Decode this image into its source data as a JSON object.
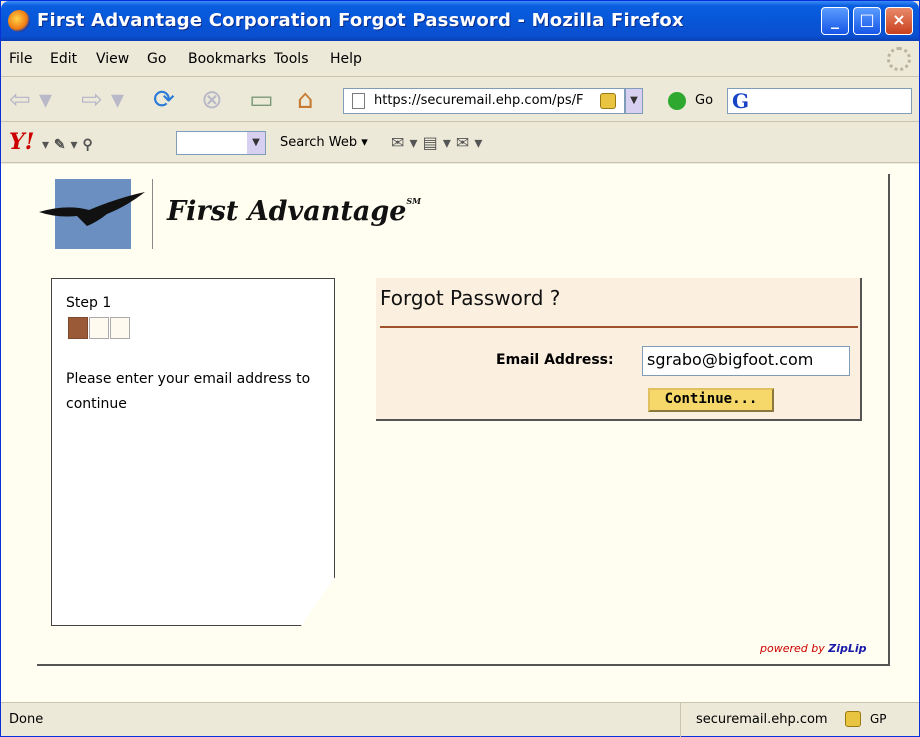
{
  "window": {
    "title": "First Advantage Corporation Forgot Password - Mozilla Firefox"
  },
  "menu": [
    "File",
    "Edit",
    "View",
    "Go",
    "Bookmarks",
    "Tools",
    "Help"
  ],
  "navbar": {
    "url": "https://securemail.ehp.com/ps/F",
    "go_label": "Go"
  },
  "yahoo": {
    "search_web": "Search Web ▾"
  },
  "page": {
    "brand": "First Advantage",
    "brand_mark": "SM",
    "step_label": "Step 1",
    "step_text": "Please enter your email address to continue",
    "form_title": "Forgot Password ?",
    "email_label": "Email Address:",
    "email_value": "sgrabo@bigfoot.com",
    "continue_label": "Continue...",
    "powered_by": "powered by",
    "powered_brand": "ZipLip"
  },
  "status": {
    "left": "Done",
    "host": "securemail.ehp.com",
    "gp": "GP"
  }
}
